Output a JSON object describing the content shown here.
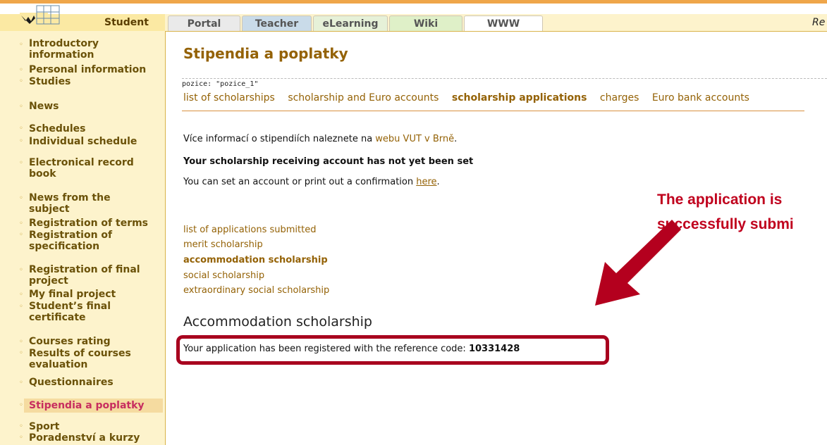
{
  "header": {
    "student_label": "Student",
    "tabs": [
      "Portal",
      "Teacher",
      "eLearning",
      "Wiki",
      "WWW"
    ],
    "right_text": "Re"
  },
  "sidebar": {
    "items": [
      {
        "label": "Introductory information"
      },
      {
        "label": "Personal information"
      },
      {
        "label": "Studies"
      },
      {
        "label": "News"
      },
      {
        "label": "Schedules"
      },
      {
        "label": "Individual schedule"
      },
      {
        "label": "Electronical record book"
      },
      {
        "label": "News from the subject"
      },
      {
        "label": "Registration of terms"
      },
      {
        "label": "Registration of specification"
      },
      {
        "label": "Registration of final project"
      },
      {
        "label": "My final project"
      },
      {
        "label": "Student’s final certificate"
      },
      {
        "label": "Courses rating"
      },
      {
        "label": "Results of courses evaluation"
      },
      {
        "label": "Questionnaires"
      },
      {
        "label": "Stipendia a poplatky"
      },
      {
        "label": "Sport"
      },
      {
        "label": "Poradenství a kurzy"
      }
    ],
    "active_index": 16
  },
  "main": {
    "title": "Stipendia a poplatky",
    "position_text": "pozice: \"pozice_1\"",
    "subnav": [
      "list of scholarships",
      "scholarship and Euro accounts",
      "scholarship applications",
      "charges",
      "Euro bank accounts"
    ],
    "subnav_active": "scholarship applications",
    "info_prefix": "Více informací o stipendiích naleznete na ",
    "info_link": "webu VUT v Brně",
    "info_suffix": ".",
    "account_warning": "Your scholarship receiving account has not yet been set",
    "set_account_prefix": "You can set an account or print out a confirmation ",
    "set_account_link": "here",
    "set_account_suffix": ".",
    "app_links": [
      "list of applications submitted",
      "merit scholarship",
      "accommodation scholarship",
      "social scholarship",
      "extraordinary social scholarship"
    ],
    "section_title": "Accommodation scholarship",
    "result_prefix": "Your application has been registered with the reference code: ",
    "result_code": "10331428"
  },
  "annotation": {
    "line1": "The application is",
    "line2": "successfully submi",
    "color": "#c0001d"
  }
}
